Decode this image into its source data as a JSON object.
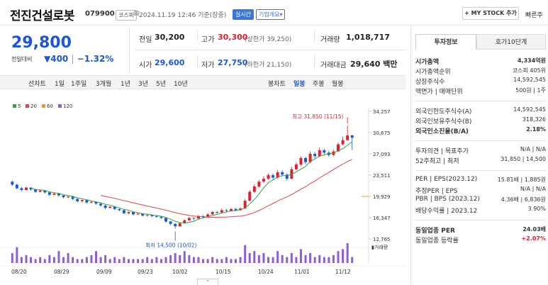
{
  "header": {
    "name": "전진건설로봇",
    "code": "079900",
    "market": "코스피",
    "time": "2024.11.19 12:46 기준(장중)",
    "realtime": "실시간",
    "overview": "기업개요",
    "my_stock": "+ MY STOCK 추가",
    "quick_view": "빠른주"
  },
  "quote": {
    "price": "29,800",
    "change_label": "전일대비",
    "change": "▼400",
    "change_pct": "−1.32%",
    "prev_close_label": "전일",
    "prev_close": "30,200",
    "open_label": "시가",
    "open": "29,600",
    "high_label": "고가",
    "high": "30,300",
    "upper_limit": "(상한가 39,250)",
    "low_label": "저가",
    "low": "27,750",
    "lower_limit": "(하한가 21,150)",
    "volume_label": "거래량",
    "volume": "1,018,717",
    "amount_label": "거래대금",
    "amount": "29,640 백만"
  },
  "toolbar": {
    "line_chart": "선차트",
    "periods": [
      "1일",
      "1주일",
      "3개월",
      "1년",
      "3년",
      "5년",
      "10년"
    ],
    "candle_chart": "봉차트",
    "candle_periods": [
      "일봉",
      "주봉",
      "월봉"
    ]
  },
  "legend": [
    {
      "label": "5",
      "color": "#35a33c"
    },
    {
      "label": "20",
      "color": "#e0424e"
    },
    {
      "label": "60",
      "color": "#f29a1a"
    },
    {
      "label": "120",
      "color": "#8d5fd3"
    }
  ],
  "chart_data": {
    "type": "candlestick",
    "x_ticks": [
      "08/20",
      "08/29",
      "09/09",
      "09/23",
      "10/02",
      "10/15",
      "10/24",
      "11/01",
      "11/12"
    ],
    "y_ticks": [
      "34,257",
      "30,675",
      "27,093",
      "23,511",
      "19,929",
      "16,347",
      "12,765"
    ],
    "ylim": [
      12765,
      34257
    ],
    "max_annotation": "최고 31,850 (11/15)",
    "min_annotation": "최저 14,500 (10/02)",
    "volume_label": "거래량",
    "candles": [
      [
        22400,
        21900,
        22600,
        21700
      ],
      [
        21900,
        21300,
        22100,
        21100
      ],
      [
        21300,
        21000,
        21500,
        20800
      ],
      [
        21000,
        21400,
        21600,
        20900
      ],
      [
        21400,
        21100,
        21500,
        20900
      ],
      [
        21100,
        20700,
        21200,
        20500
      ],
      [
        20700,
        20900,
        21100,
        20600
      ],
      [
        20900,
        20600,
        21000,
        20400
      ],
      [
        20600,
        20200,
        20700,
        20000
      ],
      [
        20200,
        20400,
        20600,
        20100
      ],
      [
        20400,
        20100,
        20500,
        19900
      ],
      [
        20100,
        19800,
        20200,
        19600
      ],
      [
        19800,
        19900,
        20100,
        19600
      ],
      [
        19900,
        19500,
        20000,
        19300
      ],
      [
        19500,
        19100,
        19600,
        18900
      ],
      [
        19100,
        19300,
        19400,
        18900
      ],
      [
        19300,
        18900,
        19400,
        18700
      ],
      [
        18900,
        19000,
        19200,
        18700
      ],
      [
        19000,
        18700,
        19100,
        18500
      ],
      [
        18700,
        18400,
        18800,
        18200
      ],
      [
        18400,
        18000,
        18500,
        17800
      ],
      [
        18000,
        18200,
        18300,
        17900
      ],
      [
        18200,
        17800,
        18300,
        17600
      ],
      [
        17800,
        17600,
        17900,
        17400
      ],
      [
        17600,
        17100,
        17700,
        16900
      ],
      [
        17100,
        17300,
        17400,
        16900
      ],
      [
        17300,
        16900,
        17400,
        16700
      ],
      [
        16900,
        17000,
        17200,
        16800
      ],
      [
        17000,
        16700,
        17100,
        16500
      ],
      [
        16700,
        16800,
        16900,
        16500
      ],
      [
        16800,
        16600,
        16900,
        16400
      ],
      [
        16600,
        16500,
        16700,
        16300
      ],
      [
        16500,
        16300,
        16600,
        16100
      ],
      [
        16300,
        15700,
        16400,
        15500
      ],
      [
        15700,
        15300,
        15800,
        15100
      ],
      [
        15300,
        14900,
        15400,
        14500
      ],
      [
        14900,
        15400,
        15500,
        14800
      ],
      [
        15400,
        15900,
        16100,
        15300
      ],
      [
        15900,
        16300,
        16500,
        15800
      ],
      [
        16300,
        16200,
        16400,
        15900
      ],
      [
        16200,
        16600,
        16800,
        16100
      ],
      [
        16600,
        16500,
        16800,
        16300
      ],
      [
        16500,
        16900,
        17100,
        16400
      ],
      [
        16900,
        17300,
        17500,
        16800
      ],
      [
        17300,
        17200,
        17500,
        17000
      ],
      [
        17200,
        17600,
        17900,
        17100
      ],
      [
        17600,
        17500,
        17800,
        17300
      ],
      [
        17500,
        17800,
        18000,
        17400
      ],
      [
        17800,
        17600,
        18000,
        17400
      ],
      [
        17600,
        17900,
        18100,
        17500
      ],
      [
        17900,
        19200,
        19500,
        17800
      ],
      [
        19200,
        20700,
        21000,
        19100
      ],
      [
        20700,
        21600,
        22000,
        20500
      ],
      [
        21600,
        22400,
        22700,
        21400
      ],
      [
        22400,
        22900,
        23300,
        22200
      ],
      [
        22900,
        23500,
        23800,
        22700
      ],
      [
        23500,
        23100,
        23800,
        22800
      ],
      [
        23100,
        24000,
        24400,
        22900
      ],
      [
        24000,
        23600,
        24300,
        23300
      ],
      [
        23600,
        22900,
        23800,
        22600
      ],
      [
        22900,
        24500,
        24900,
        22800
      ],
      [
        24500,
        25300,
        25700,
        24300
      ],
      [
        25300,
        26400,
        26700,
        25000
      ],
      [
        26400,
        25700,
        26600,
        25300
      ],
      [
        25700,
        27100,
        27500,
        25500
      ],
      [
        27100,
        26700,
        27400,
        26300
      ],
      [
        26700,
        27700,
        28200,
        26500
      ],
      [
        27700,
        27300,
        28000,
        27000
      ],
      [
        27300,
        26900,
        27600,
        26600
      ],
      [
        26900,
        27500,
        27800,
        26700
      ],
      [
        27500,
        28700,
        29000,
        27400
      ],
      [
        28700,
        29400,
        30000,
        28500
      ],
      [
        29400,
        30200,
        31850,
        29300
      ],
      [
        30200,
        29800,
        30300,
        27750
      ]
    ],
    "volumes": [
      0.5,
      0.8,
      0.3,
      0.4,
      0.3,
      0.2,
      0.3,
      0.2,
      0.4,
      0.3,
      0.6,
      0.3,
      0.5,
      0.3,
      0.2,
      0.2,
      0.3,
      0.4,
      0.6,
      0.3,
      0.4,
      0.2,
      0.3,
      0.2,
      0.3,
      0.2,
      0.2,
      0.2,
      0.2,
      0.3,
      0.2,
      0.3,
      0.2,
      0.3,
      0.4,
      0.5,
      0.4,
      0.6,
      0.4,
      0.3,
      0.3,
      0.2,
      0.2,
      0.3,
      0.2,
      0.2,
      0.3,
      0.2,
      0.2,
      0.3,
      0.9,
      0.5,
      0.6,
      0.4,
      0.5,
      0.3,
      0.3,
      0.6,
      0.4,
      0.3,
      0.5,
      0.3,
      0.7,
      0.4,
      0.5,
      0.3,
      0.4,
      0.3,
      0.3,
      0.4,
      0.6,
      0.7,
      1.0,
      0.3
    ]
  },
  "right_panel": {
    "tab_active": "투자정보",
    "tab_other": "호가10단계",
    "rows": [
      {
        "k": "시가총액",
        "v": "4,334억원",
        "bold": true
      },
      {
        "k": "시가총액순위",
        "v": "코스피 405위"
      },
      {
        "k": "상장주식수",
        "v": "14,592,545"
      },
      {
        "k": "액면가 | 매매단위",
        "v": "500원 | 1주"
      },
      {
        "k": "외국인한도주식수(A)",
        "v": "14,592,545"
      },
      {
        "k": "외국인보유주식수(B)",
        "v": "318,326"
      },
      {
        "k": "외국인소진율(B/A)",
        "v": "2.18%",
        "bold": true
      },
      {
        "k": "투자의견 | 목표주가",
        "v": "N/A | N/A"
      },
      {
        "k": "52주최고 | 최저",
        "v": "31,850 | 14,500"
      },
      {
        "k": "PER | EPS(2023.12)",
        "v": "15.81배 | 1,885원"
      },
      {
        "k": "추정PER | EPS",
        "v": "N/A | N/A"
      },
      {
        "k": "PBR | BPS (2023.12)",
        "v": "4.36배 | 6,836원"
      },
      {
        "k": "배당수익률 | 2023.12",
        "v": "3.90%"
      },
      {
        "k": "동일업종 PER",
        "v": "24.03배",
        "bold": true
      },
      {
        "k": "동일업종 등락률",
        "v": "+2.07%",
        "red": true
      }
    ]
  }
}
